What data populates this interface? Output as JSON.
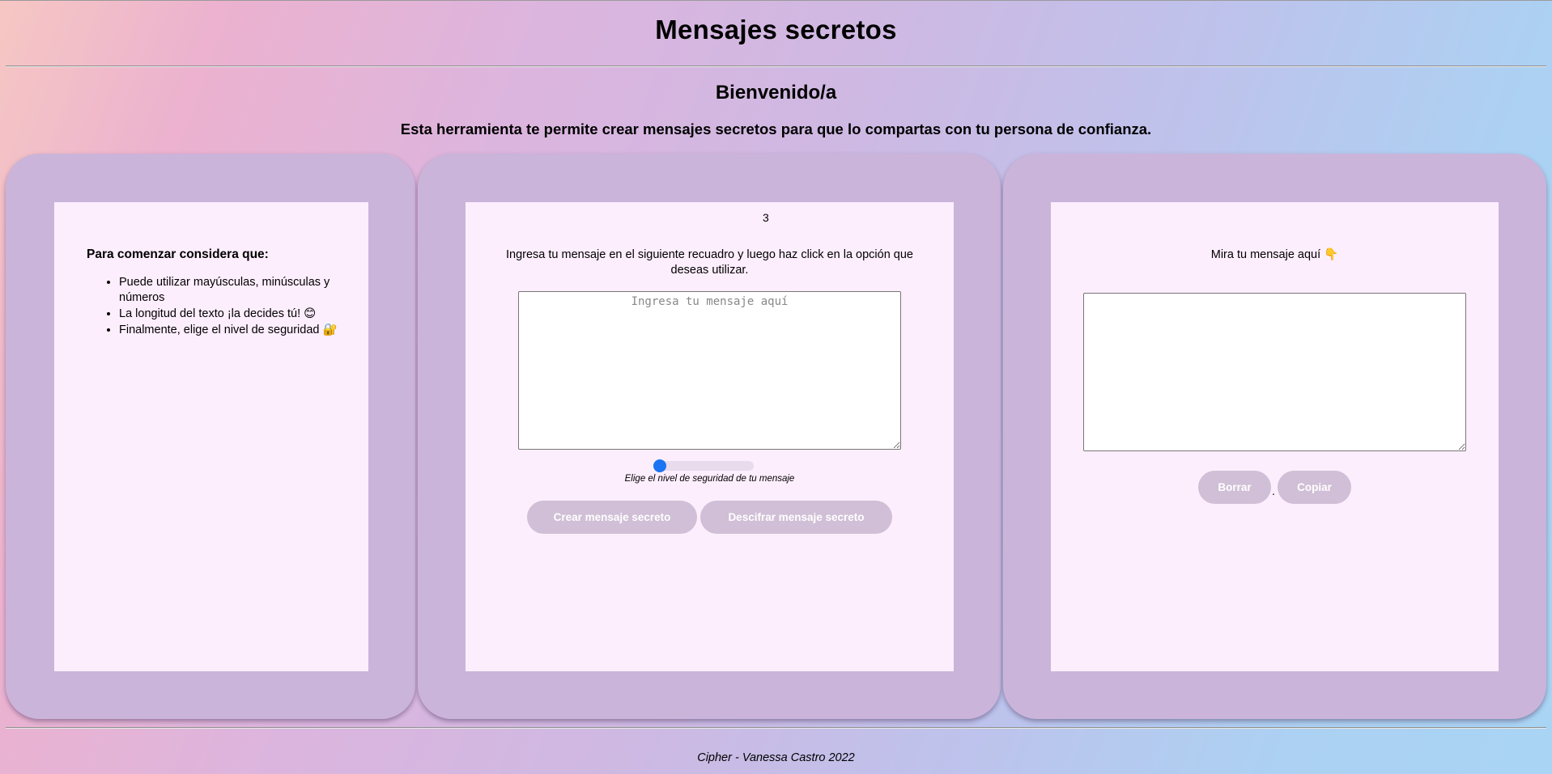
{
  "header": {
    "title": "Mensajes secretos",
    "welcome": "Bienvenido/a",
    "intro": "Esta herramienta te permite crear mensajes secretos para que lo compartas con tu persona de confianza."
  },
  "tips": {
    "title": "Para comenzar considera que:",
    "items": [
      "Puede utilizar mayúsculas, minúsculas y números",
      "La longitud del texto ¡la decides tú! 😊",
      "Finalmente, elige el nivel de seguridad 🔐"
    ]
  },
  "input_panel": {
    "instruction": "Ingresa tu mensaje en el siguiente recuadro y luego haz click en la opción que deseas utilizar.",
    "textarea_placeholder": "Ingresa tu mensaje aquí",
    "textarea_value": "",
    "slider_value": "3",
    "slider_level": 0,
    "slider_hint": "Elige el nivel de seguridad de tu mensaje",
    "create_button": "Crear mensaje secreto",
    "decode_button": "Descifrar mensaje secreto"
  },
  "output_panel": {
    "title": "Mira tu mensaje aquí 👇",
    "textarea_value": "",
    "clear_button": "Borrar",
    "separator": ".",
    "copy_button": "Copiar"
  },
  "footer": {
    "text": "Cipher - Vanessa Castro 2022"
  },
  "colors": {
    "card": "#cbb4da",
    "panel": "#fdeefd",
    "button": "#d0bfd6",
    "slider_thumb": "#1b74f1"
  }
}
